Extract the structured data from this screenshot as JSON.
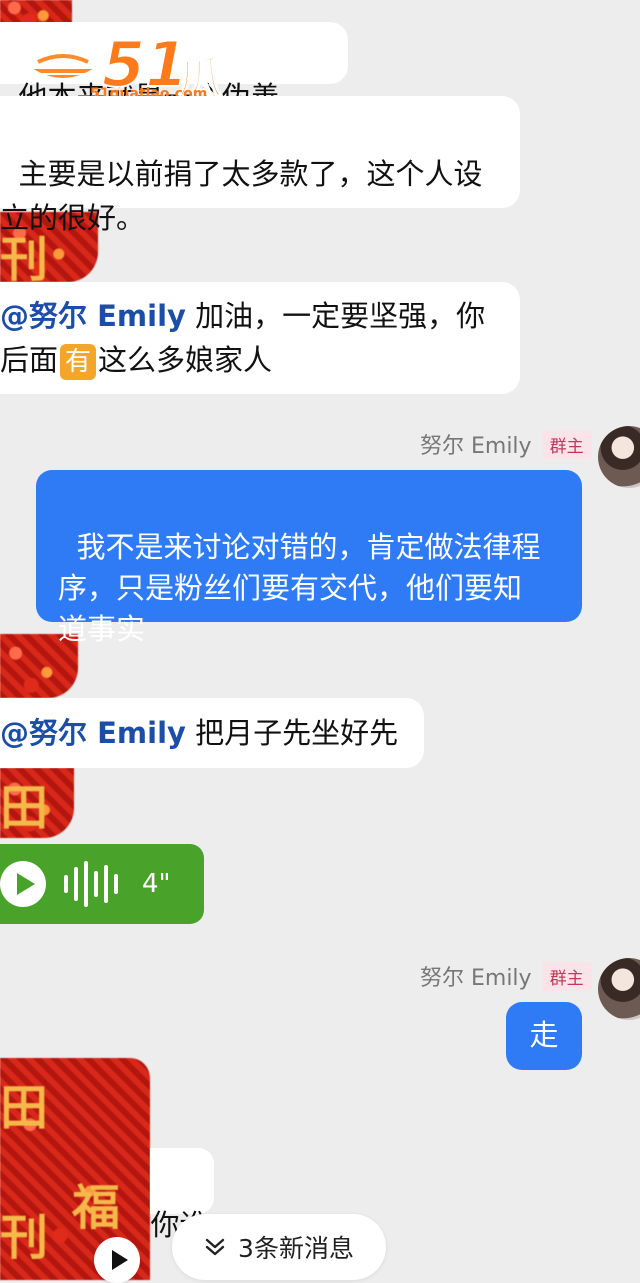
{
  "messages": {
    "m1_text": "他本来就是一个伪善了，",
    "m2_text": "主要是以前捐了太多款了，这个人设\n立的很好。",
    "m3_mention": "@努尔 Emily",
    "m3_text_a": " 加油，一定要坚强，你\n后面",
    "m3_emoji": "有",
    "m3_text_b": "这么多娘家人",
    "m4_sender": "努尔 Emily",
    "m4_role": "群主",
    "m4_text": "我不是来讨论对错的，肯定做法律程\n序，只是粉丝们要有交代，他们要知\n道事实",
    "m5_mention": "@努尔 Emily",
    "m5_text": " 把月子先坐好先",
    "m6_duration": "4\"",
    "m7_sender": "努尔 Emily",
    "m7_role": "群主",
    "m7_text": "走",
    "m8_text": "你谁"
  },
  "watermark": {
    "brand_num": "51",
    "brand_cn": "瓜条",
    "url": "51guatiao.com"
  },
  "new_messages_label": "3条新消息",
  "colors": {
    "background": "#ededed",
    "own_bubble": "#2f7bf6",
    "voice_bubble": "#49a22a",
    "mention": "#1c4ea8",
    "brand": "#ff7a1a"
  },
  "icons": [
    "play-icon",
    "chevron-down-double-icon",
    "voice-wave-icon"
  ]
}
